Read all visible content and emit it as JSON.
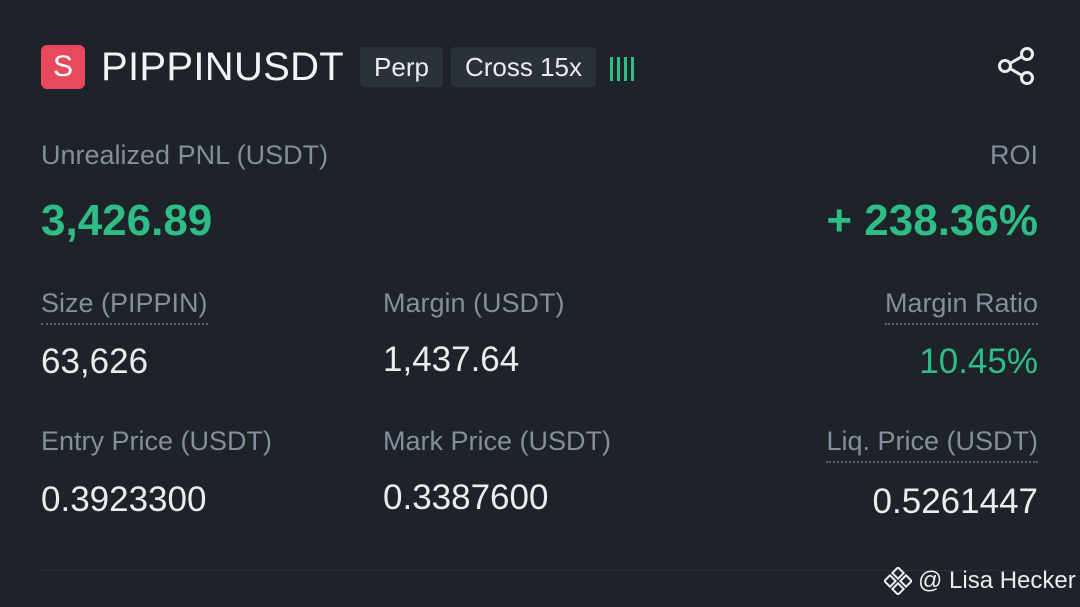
{
  "header": {
    "coin_letter": "S",
    "symbol": "PIPPINUSDT",
    "tag_type": "Perp",
    "tag_margin": "Cross 15x",
    "share_icon": "share-icon"
  },
  "pnl": {
    "label": "Unrealized PNL (USDT)",
    "value": "3,426.89",
    "roi_label": "ROI",
    "roi_value": "+ 238.36%"
  },
  "stats": {
    "size_label": "Size (PIPPIN)",
    "size_value": "63,626",
    "margin_label": "Margin (USDT)",
    "margin_value": "1,437.64",
    "margin_ratio_label": "Margin Ratio",
    "margin_ratio_value": "10.45%",
    "entry_label": "Entry Price (USDT)",
    "entry_value": "0.3923300",
    "mark_label": "Mark Price (USDT)",
    "mark_value": "0.3387600",
    "liq_label": "Liq. Price (USDT)",
    "liq_value": "0.5261447"
  },
  "watermark": {
    "text": "@ Lisa Hecker"
  },
  "colors": {
    "background": "#1e2329",
    "positive": "#2ebd85",
    "coin_badge": "#e8495f",
    "muted": "#848e9c"
  }
}
